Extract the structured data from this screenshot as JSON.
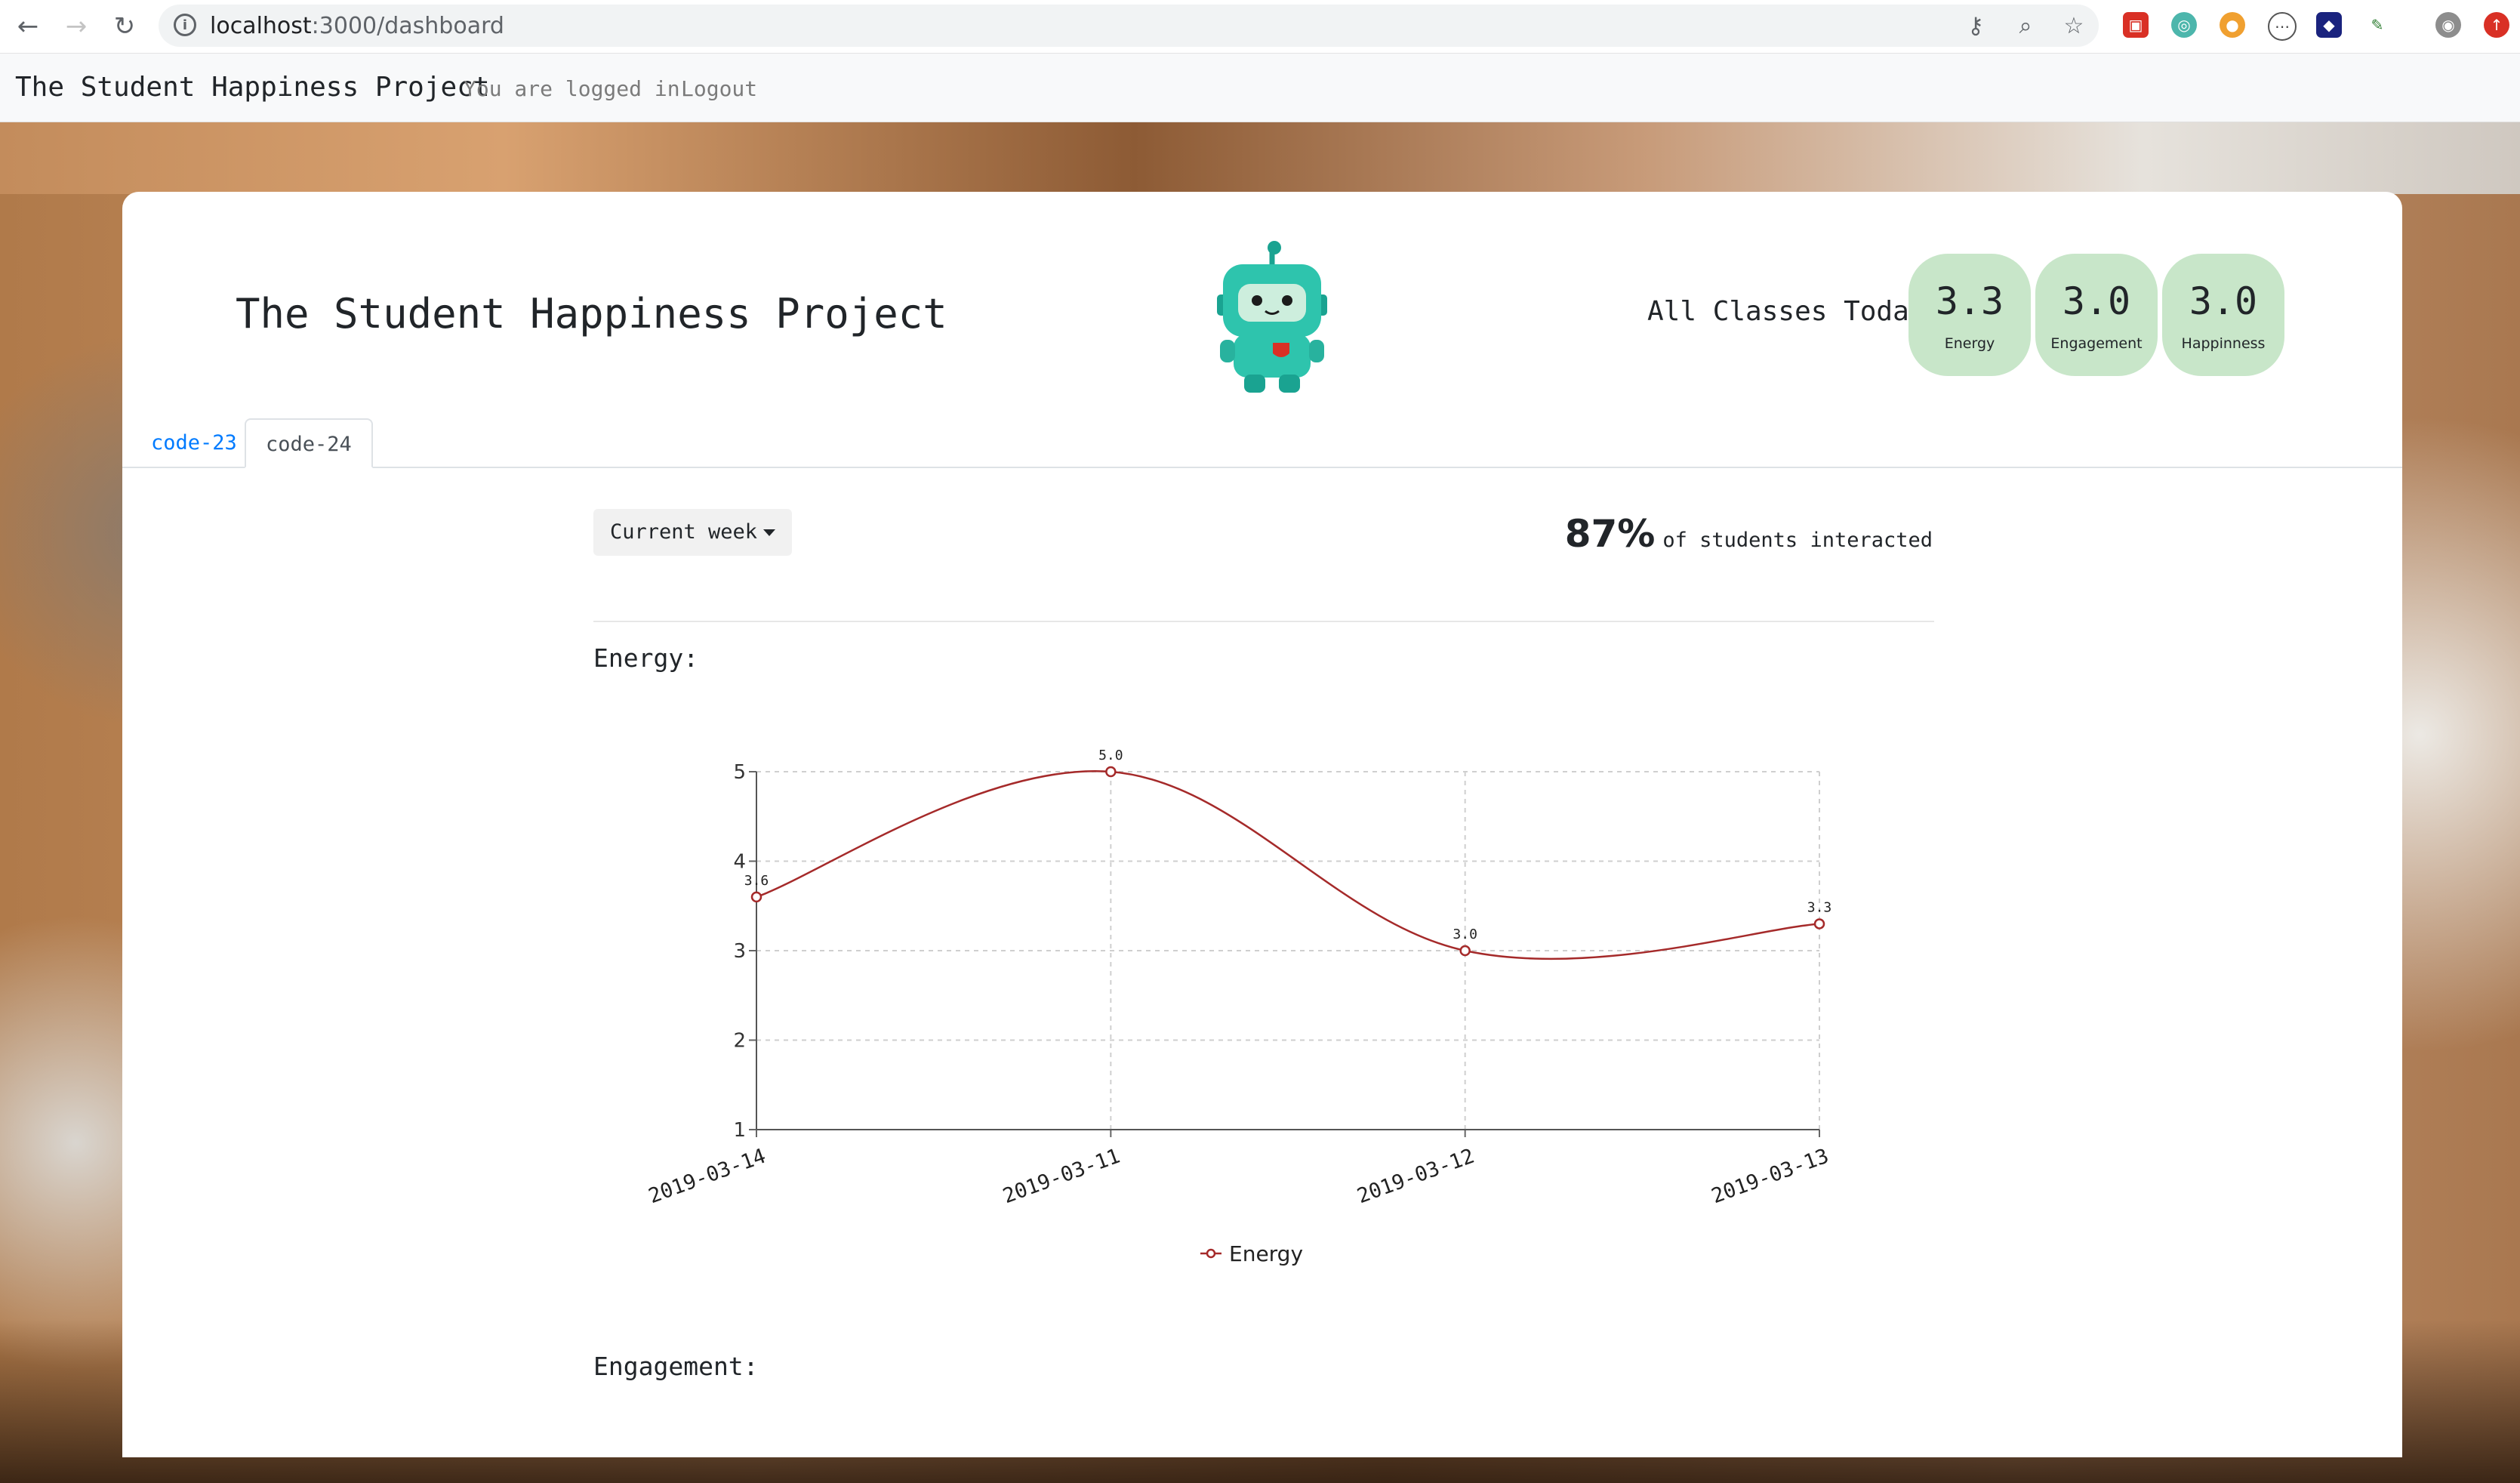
{
  "browser": {
    "url_host": "localhost",
    "url_path": ":3000/dashboard"
  },
  "navbar": {
    "brand": "The Student Happiness Project",
    "status": "You are logged in",
    "logout": "Logout"
  },
  "header": {
    "title": "The Student Happiness Project",
    "today_label": "All Classes Today:",
    "metrics": [
      {
        "value": "3.3",
        "label": "Energy"
      },
      {
        "value": "3.0",
        "label": "Engagement"
      },
      {
        "value": "3.0",
        "label": "Happinness"
      }
    ]
  },
  "tabs": [
    {
      "label": "code-23",
      "active": false
    },
    {
      "label": "code-24",
      "active": true
    }
  ],
  "filter": {
    "selected": "Current week"
  },
  "interaction": {
    "percent": "87%",
    "text": "of students interacted"
  },
  "sections": {
    "energy_title": "Energy:",
    "engagement_title": "Engagement:"
  },
  "colors": {
    "pill": "#c8e6c9",
    "link": "#007bff",
    "series": "#a52a2a"
  },
  "chart_data": {
    "type": "line",
    "categories": [
      "2019-03-14",
      "2019-03-11",
      "2019-03-12",
      "2019-03-13"
    ],
    "series": [
      {
        "name": "Energy",
        "values": [
          3.6,
          5.0,
          3.0,
          3.3
        ],
        "labels": [
          "3.6",
          "5.0",
          "3.0",
          "3.3"
        ]
      }
    ],
    "ylim": [
      1,
      5
    ],
    "yticks": [
      1,
      2,
      3,
      4,
      5
    ],
    "grid": true,
    "legend": "bottom",
    "smooth": true
  }
}
